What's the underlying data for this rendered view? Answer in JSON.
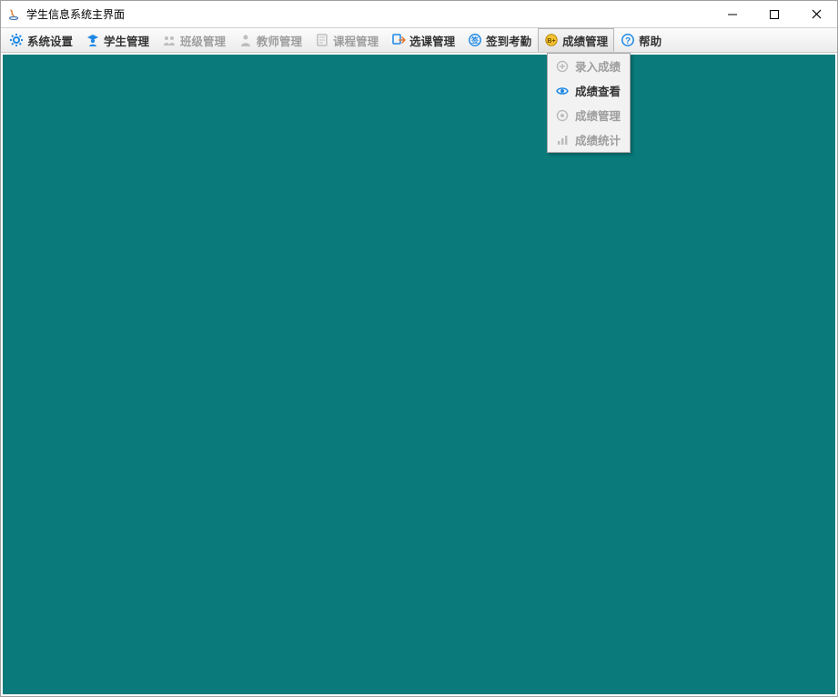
{
  "window": {
    "title": "学生信息系统主界面"
  },
  "menubar": {
    "items": [
      {
        "label": "系统设置",
        "icon": "gear-icon",
        "enabled": true
      },
      {
        "label": "学生管理",
        "icon": "student-icon",
        "enabled": true
      },
      {
        "label": "班级管理",
        "icon": "class-icon",
        "enabled": false
      },
      {
        "label": "教师管理",
        "icon": "teacher-icon",
        "enabled": false
      },
      {
        "label": "课程管理",
        "icon": "course-icon",
        "enabled": false
      },
      {
        "label": "选课管理",
        "icon": "select-course-icon",
        "enabled": true
      },
      {
        "label": "签到考勤",
        "icon": "attendance-icon",
        "enabled": true
      },
      {
        "label": "成绩管理",
        "icon": "grade-icon",
        "enabled": true,
        "active": true
      },
      {
        "label": "帮助",
        "icon": "help-icon",
        "enabled": true
      }
    ]
  },
  "dropdown": {
    "items": [
      {
        "label": "录入成绩",
        "icon": "add-circle-icon",
        "enabled": false
      },
      {
        "label": "成绩查看",
        "icon": "eye-icon",
        "enabled": true
      },
      {
        "label": "成绩管理",
        "icon": "manage-icon",
        "enabled": false
      },
      {
        "label": "成绩统计",
        "icon": "chart-icon",
        "enabled": false
      }
    ]
  }
}
